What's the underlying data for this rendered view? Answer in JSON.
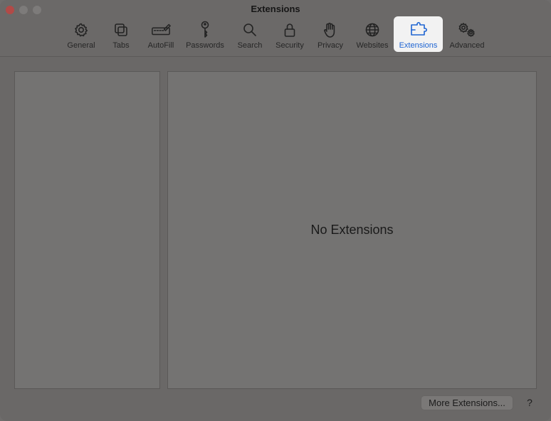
{
  "window": {
    "title": "Extensions"
  },
  "toolbar": {
    "items": [
      {
        "label": "General",
        "icon": "gear-icon"
      },
      {
        "label": "Tabs",
        "icon": "tabs-icon"
      },
      {
        "label": "AutoFill",
        "icon": "autofill-icon"
      },
      {
        "label": "Passwords",
        "icon": "key-icon"
      },
      {
        "label": "Search",
        "icon": "search-icon"
      },
      {
        "label": "Security",
        "icon": "lock-icon"
      },
      {
        "label": "Privacy",
        "icon": "hand-icon"
      },
      {
        "label": "Websites",
        "icon": "globe-icon"
      },
      {
        "label": "Extensions",
        "icon": "puzzle-icon",
        "active": true
      },
      {
        "label": "Advanced",
        "icon": "gears-icon"
      }
    ],
    "active_color": "#1e64d2"
  },
  "main": {
    "empty_message": "No Extensions"
  },
  "footer": {
    "more_label": "More Extensions...",
    "help_label": "?"
  }
}
